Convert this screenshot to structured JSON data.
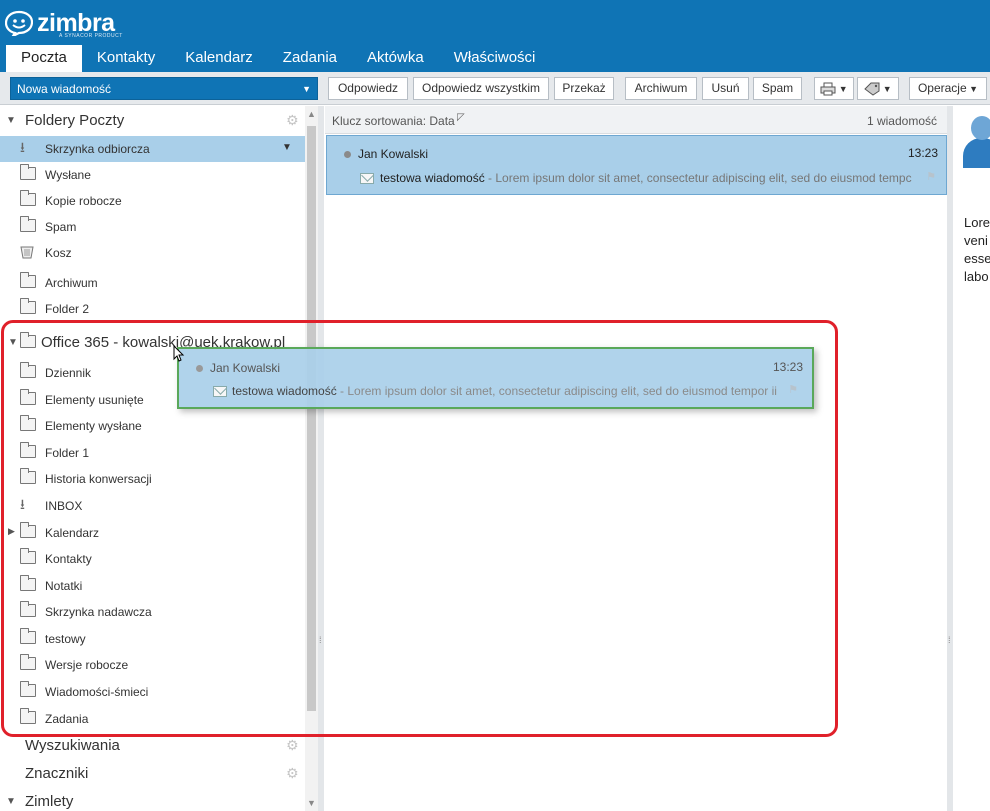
{
  "header": {
    "logo_word": "zimbra",
    "logo_sub": "A SYNACOR PRODUCT",
    "tabs": [
      "Poczta",
      "Kontakty",
      "Kalendarz",
      "Zadania",
      "Aktówka",
      "Właściwości"
    ],
    "active_tab": "Poczta"
  },
  "toolbar": {
    "new_message": "Nowa wiadomość",
    "reply": "Odpowiedz",
    "reply_all": "Odpowiedz wszystkim",
    "forward": "Przekaż",
    "archive": "Archiwum",
    "delete": "Usuń",
    "spam": "Spam",
    "actions": "Operacje"
  },
  "sidebar": {
    "mail_folders_header": "Foldery Poczty",
    "local_folders": [
      {
        "label": "Skrzynka odbiorcza",
        "icon": "download-icon",
        "selected": true
      },
      {
        "label": "Wysłane",
        "icon": "sent-folder-icon"
      },
      {
        "label": "Kopie robocze",
        "icon": "drafts-folder-icon"
      },
      {
        "label": "Spam",
        "icon": "spam-folder-icon"
      },
      {
        "label": "Kosz",
        "icon": "trash-icon"
      },
      {
        "label": "Archiwum",
        "icon": "folder-icon"
      },
      {
        "label": "Folder 2",
        "icon": "folder-icon"
      }
    ],
    "account_header": "Office 365 - kowalski@uek.krakow.pl",
    "account_folders": [
      {
        "label": "Dziennik",
        "icon": "folder-icon"
      },
      {
        "label": "Elementy usunięte",
        "icon": "folder-icon"
      },
      {
        "label": "Elementy wysłane",
        "icon": "folder-icon"
      },
      {
        "label": "Folder 1",
        "icon": "folder-icon"
      },
      {
        "label": "Historia konwersacji",
        "icon": "folder-icon"
      },
      {
        "label": "INBOX",
        "icon": "download-icon"
      },
      {
        "label": "Kalendarz",
        "icon": "folder-icon",
        "expandable": true
      },
      {
        "label": "Kontakty",
        "icon": "folder-icon"
      },
      {
        "label": "Notatki",
        "icon": "folder-icon"
      },
      {
        "label": "Skrzynka nadawcza",
        "icon": "folder-icon"
      },
      {
        "label": "testowy",
        "icon": "folder-icon"
      },
      {
        "label": "Wersje robocze",
        "icon": "folder-icon"
      },
      {
        "label": "Wiadomości-śmieci",
        "icon": "folder-icon"
      },
      {
        "label": "Zadania",
        "icon": "folder-icon"
      }
    ],
    "searches_header": "Wyszukiwania",
    "tags_header": "Znaczniki",
    "zimlets_header": "Zimlety"
  },
  "message_list": {
    "sort_label": "Klucz sortowania: Data",
    "count_label": "1 wiadomość",
    "message": {
      "sender": "Jan Kowalski",
      "time": "13:23",
      "subject": "testowa wiadomość",
      "preview_selected": " - Lorem ipsum dolor sit amet, consectetur adipiscing elit, sed do eiusmod tempc",
      "preview_ghost": " - Lorem ipsum dolor sit amet, consectetur adipiscing elit, sed do eiusmod tempor ii"
    }
  },
  "reading_pane": {
    "text_lines": [
      "Lore",
      "veni",
      "esse",
      "labo"
    ]
  },
  "colors": {
    "brand": "#0f74b5",
    "selection": "#a9cfe9",
    "highlight": "#e0202a",
    "drop_border": "#5aa85a"
  }
}
